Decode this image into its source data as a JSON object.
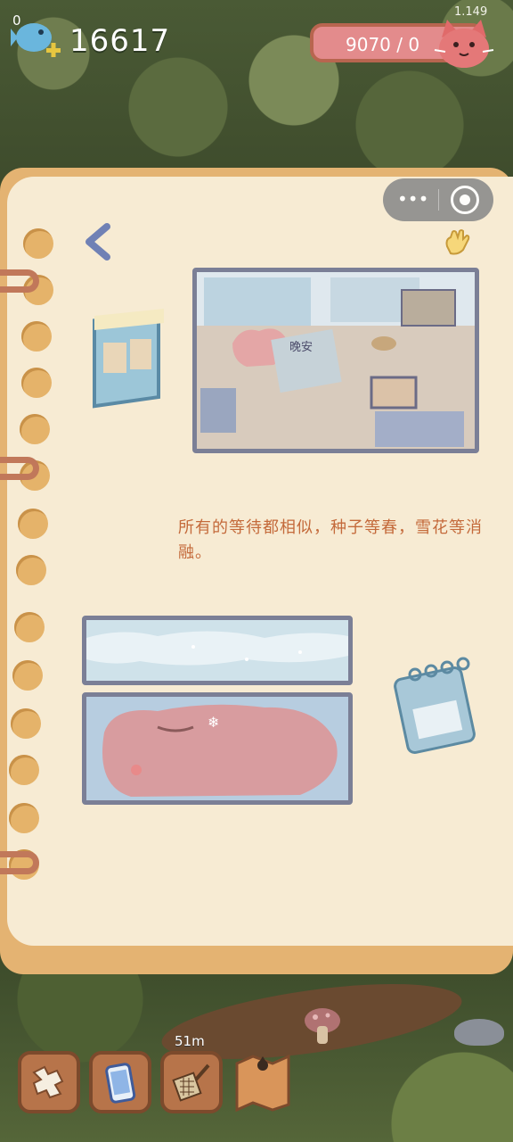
{
  "hud": {
    "notification_count": "0",
    "coins": "16617",
    "stamina": "9070 / 0",
    "version": "1.149"
  },
  "story": {
    "paragraph": "所有的等待都相似，种子等春，雪花等消融。",
    "picture_sign": "晚安"
  },
  "toolbar": {
    "distance_label": "51m",
    "buttons": [
      {
        "icon": "puzzle-icon"
      },
      {
        "icon": "phone-icon"
      },
      {
        "icon": "sieve-icon"
      },
      {
        "icon": "map-icon"
      }
    ]
  },
  "colors": {
    "page": "#f7ebd3",
    "notebook_border": "#e4b372",
    "text_accent": "#c46a3b",
    "frame": "#7b7f96",
    "stamina": "#e38b8c"
  }
}
